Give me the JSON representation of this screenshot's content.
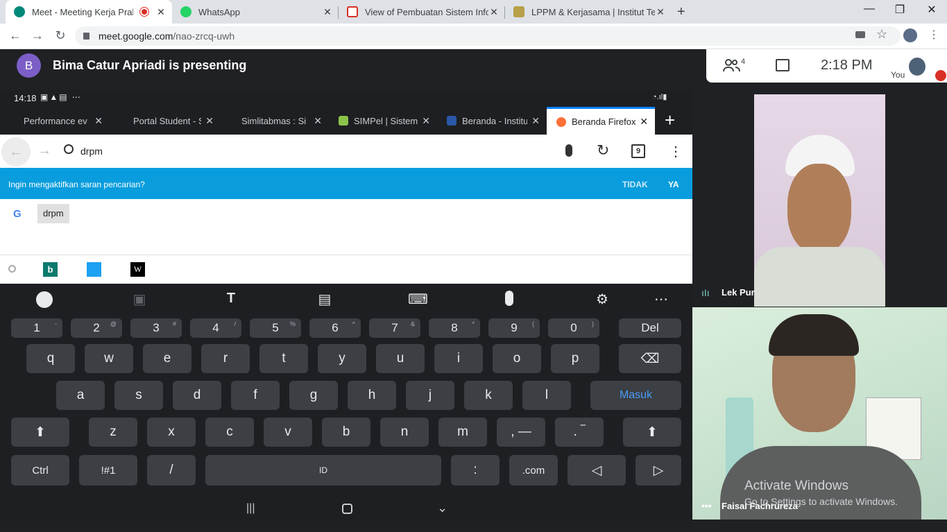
{
  "browser": {
    "tabs": [
      {
        "title": "Meet - Meeting Kerja Praktek",
        "active": true
      },
      {
        "title": "WhatsApp",
        "active": false
      },
      {
        "title": "View of Pembuatan Sistem Inform",
        "active": false
      },
      {
        "title": "LPPM & Kerjasama | Institut Tekn",
        "active": false
      }
    ],
    "url_host": "meet.google.com",
    "url_path": "/nao-zrcq-uwh"
  },
  "meet": {
    "presenter_initial": "B",
    "presenting_text": "Bima Catur Apriadi is presenting",
    "participants_count": "4",
    "time": "2:18  PM",
    "you_label": "You",
    "participants": [
      {
        "name": "Lek Pur"
      },
      {
        "name": "Faisal Fachrureza"
      }
    ],
    "watermark_title": "Activate Windows",
    "watermark_sub": "Go to Settings to activate Windows."
  },
  "phone": {
    "clock": "14:18",
    "firefox_tabs": [
      {
        "title": "Performance ev"
      },
      {
        "title": "Portal Student - S"
      },
      {
        "title": "Simlitabmas : Si"
      },
      {
        "title": "SIMPel | Sistem"
      },
      {
        "title": "Beranda - Institu"
      },
      {
        "title": "Beranda Firefox"
      }
    ],
    "search_text": "drpm",
    "tab_count": "9",
    "suggest_prompt": "Ingin mengaktifkan saran pencarian?",
    "suggest_no": "TIDAK",
    "suggest_yes": "YA",
    "suggestion": "drpm",
    "keyboard": {
      "numbers": [
        [
          "1",
          "-"
        ],
        [
          "2",
          "@"
        ],
        [
          "3",
          "#"
        ],
        [
          "4",
          "/"
        ],
        [
          "5",
          "%"
        ],
        [
          "6",
          "^"
        ],
        [
          "7",
          "&"
        ],
        [
          "8",
          "*"
        ],
        [
          "9",
          "("
        ],
        [
          "0",
          ")"
        ]
      ],
      "del": "Del",
      "row1": [
        "q",
        "w",
        "e",
        "r",
        "t",
        "y",
        "u",
        "i",
        "o",
        "p"
      ],
      "row2": [
        "a",
        "s",
        "d",
        "f",
        "g",
        "h",
        "j",
        "k",
        "l"
      ],
      "enter": "Masuk",
      "row3": [
        "z",
        "x",
        "c",
        "v",
        "b",
        "n",
        "m"
      ],
      "comma": ", —",
      "period": ". ‾",
      "ctrl": "Ctrl",
      "sym": "!#1",
      "slash": "/",
      "space": "ID",
      "colon": ":",
      "dotcom": ".com"
    }
  },
  "colors": {
    "accent": "#0a9ddd",
    "presenter": "#7b5fc7",
    "firefox_accent": "#0a84ff"
  }
}
